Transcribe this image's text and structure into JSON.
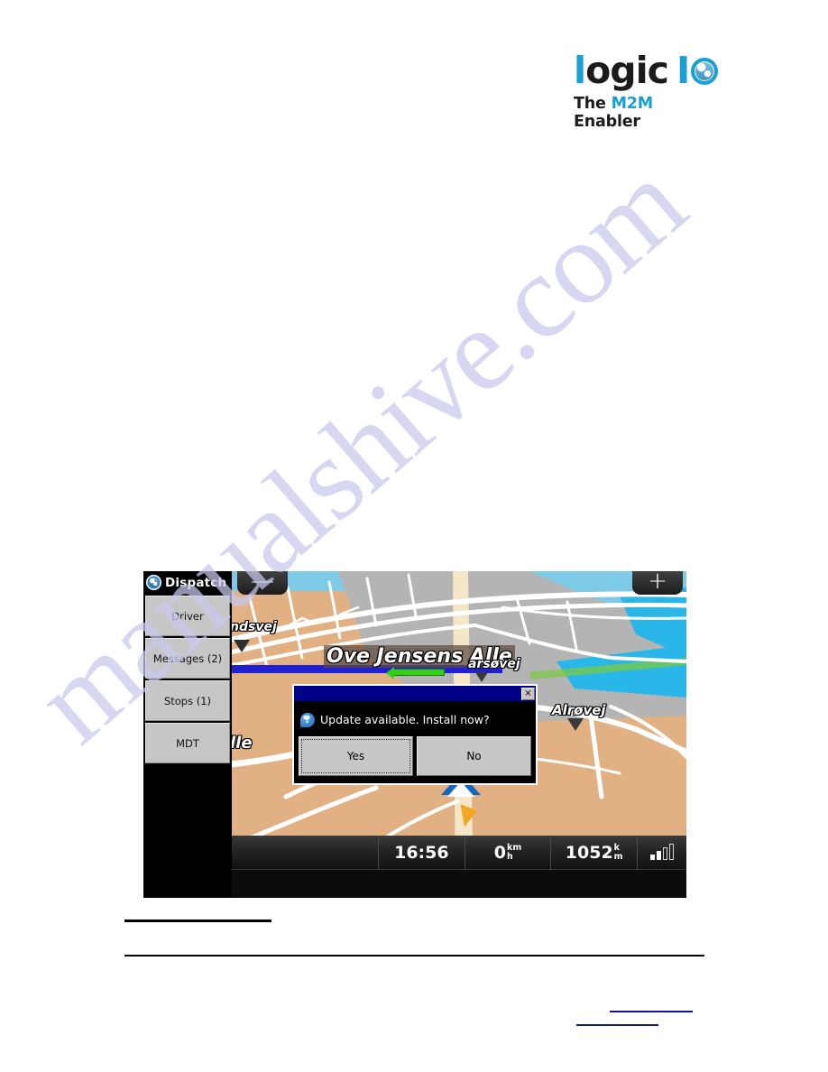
{
  "page": {
    "watermark": "manualshive.com",
    "background_color": "#ffffff"
  },
  "logo": {
    "word_first_letter": "l",
    "word_rest": "ogic",
    "word_io": "I",
    "globe_icon": "globe-icon",
    "tagline_prefix": "The ",
    "tagline_accent": "M2M",
    "tagline_suffix": " Enabler",
    "accent_color": "#1a9fd4",
    "text_color": "#1b1b1b"
  },
  "device": {
    "sidebar": {
      "icon": "globe-icon",
      "title": "Dispatch",
      "buttons": [
        {
          "label": "Driver"
        },
        {
          "label": "Messages (2)"
        },
        {
          "label": "Stops (1)"
        },
        {
          "label": "MDT"
        }
      ]
    },
    "map": {
      "zoom_out_label": "—",
      "zoom_in_label": "+",
      "labels": {
        "sandsvej": "ndsvej",
        "ove_jensens_alle": "Ove Jensens Alle",
        "carsovej": "arsøvej",
        "alle": "lle",
        "alrovej": "Alrøvej"
      },
      "colors": {
        "land": "#e2b183",
        "urban": "#b4b4b4",
        "water": "#29b6e8",
        "road": "#ffffff",
        "highway": "#f5e6c8",
        "route": "#2020d0"
      }
    },
    "dialog": {
      "message": "Update available. Install now?",
      "icon": "question-icon",
      "close_label": "×",
      "buttons": [
        {
          "label": "Yes",
          "focused": true
        },
        {
          "label": "No",
          "focused": false
        }
      ],
      "titlebar_color": "#000088"
    },
    "statusbar": {
      "time": "16:56",
      "speed_value": "0",
      "speed_unit_top": "km",
      "speed_unit_bottom": "h",
      "distance_value": "1052",
      "distance_unit_top": "k",
      "distance_unit_bottom": "m",
      "signal_icon": "signal-bars-icon"
    }
  },
  "footer": {
    "link_1_text": "",
    "link_2_text": "",
    "link_color": "#151583"
  }
}
